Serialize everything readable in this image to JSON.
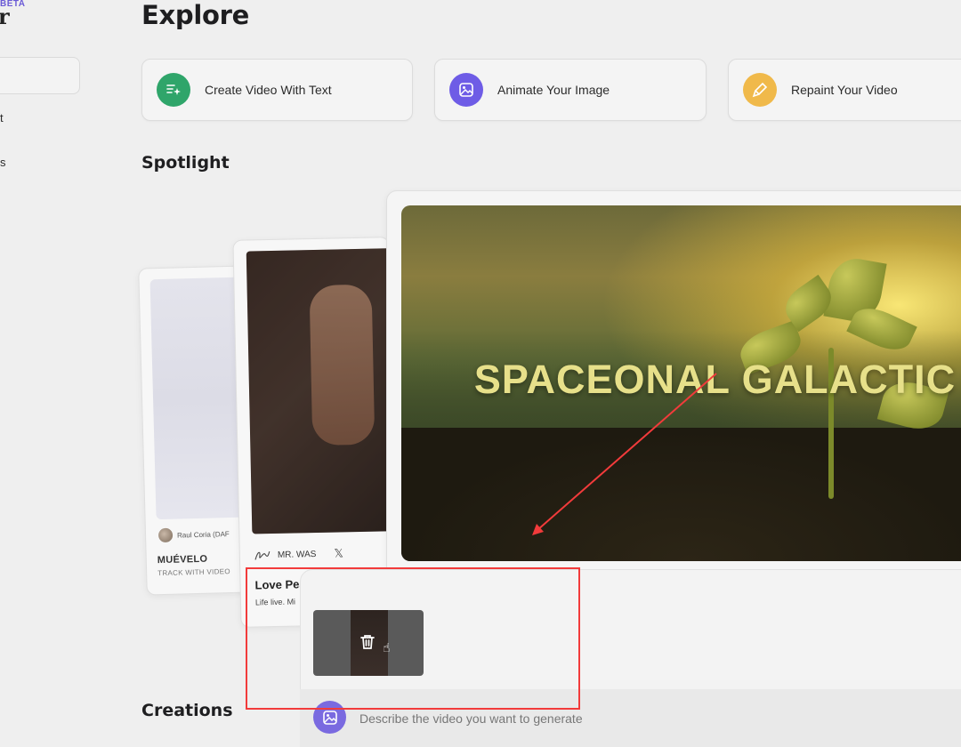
{
  "sidebar": {
    "brand_badge": "BETA",
    "brand_letter": "r",
    "items": [
      {
        "label": "t"
      },
      {
        "label": "s"
      }
    ]
  },
  "page_title": "Explore",
  "actions": [
    {
      "label": "Create Video With Text",
      "icon": "text-sparkle-icon",
      "color": "#2fa56a"
    },
    {
      "label": "Animate Your Image",
      "icon": "image-icon",
      "color": "#6e5ce6"
    },
    {
      "label": "Repaint Your Video",
      "icon": "brush-icon",
      "color": "#f0b94a"
    }
  ],
  "spotlight": {
    "heading": "Spotlight",
    "cards": [
      {
        "author": "Raul Coria (DAF",
        "title": "MUÉVELO",
        "subtitle": "TRACK WITH VIDEO"
      },
      {
        "author": "MR. WAS",
        "title": "Love Pea",
        "subtitle": "Life live. Mi"
      },
      {
        "overlay_text": "SPACEONAL GALACTIC"
      }
    ]
  },
  "creations_heading": "Creations",
  "prompt": {
    "placeholder": "Describe the video you want to generate"
  },
  "colors": {
    "accent": "#6e5ce6",
    "annotation": "#f23b3b"
  }
}
